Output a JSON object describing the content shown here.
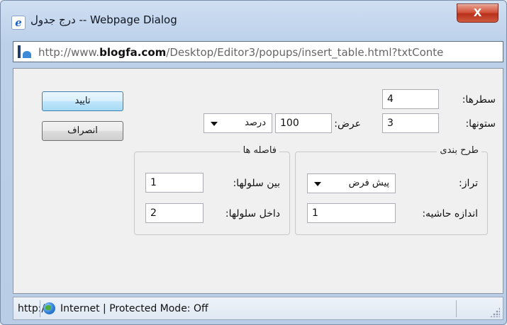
{
  "window": {
    "title": "درج جدول -- Webpage Dialog",
    "close_label": "X"
  },
  "address": {
    "url_prefix": "http://www.",
    "url_domain": "blogfa.com",
    "url_path": "/Desktop/Editor3/popups/insert_table.html?txtConte"
  },
  "buttons": {
    "ok_label": "تایید",
    "cancel_label": "انصراف"
  },
  "form": {
    "rows_label": "سطرها:",
    "rows_value": "4",
    "cols_label": "ستونها:",
    "cols_value": "3",
    "width_label": "عرض:",
    "width_value": "100",
    "width_unit": "درصد"
  },
  "layout_group": {
    "legend": "طرح بندی",
    "align_label": "تراز:",
    "align_value": "پیش فرض",
    "border_label": "اندازه حاشیه:",
    "border_value": "1"
  },
  "spacing_group": {
    "legend": "فاصله ها",
    "cellspacing_label": "بین سلولها:",
    "cellspacing_value": "1",
    "cellpadding_label": "داخل سلولها:",
    "cellpadding_value": "2"
  },
  "status": {
    "url_fragment": "http:/",
    "zone_text": "Internet | Protected Mode: Off"
  }
}
